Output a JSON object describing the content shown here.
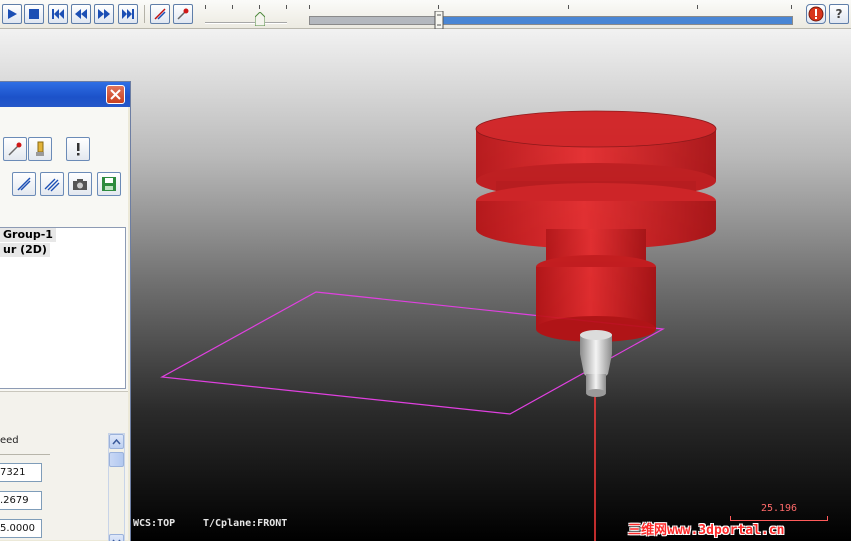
{
  "toolbar": {
    "buttons": [
      "play-icon",
      "stop-icon",
      "rewind-to-start-icon",
      "step-back-icon",
      "step-forward-icon",
      "fast-forward-icon",
      "toolpath-display-icon",
      "tool-display-icon",
      "stop-conditions-icon",
      "help-icon"
    ],
    "speed_level": 0.7,
    "progress_played": 0.27,
    "accent": "#4a86d4"
  },
  "viewport": {
    "status_wcs": "WCS:TOP",
    "status_cplane": "T/Cplane:FRONT",
    "scale_value": "25.196",
    "watermark": "三维网www.3dportal.cn",
    "tool_holder_color": "#e3191c",
    "toolpath_color": "#e040e0"
  },
  "panel": {
    "close_icon": "close-icon",
    "row1_icons": [
      "toolpath-icon",
      "tool-icon",
      "info-icon"
    ],
    "row2_icons": [
      "verify-icon",
      "backplot-icon",
      "camera-icon",
      "save-icon"
    ],
    "tree": [
      "Group-1",
      "ur (2D)"
    ],
    "info_label": "eed",
    "info_values": [
      "7321",
      ".2679",
      "5.0000"
    ]
  }
}
